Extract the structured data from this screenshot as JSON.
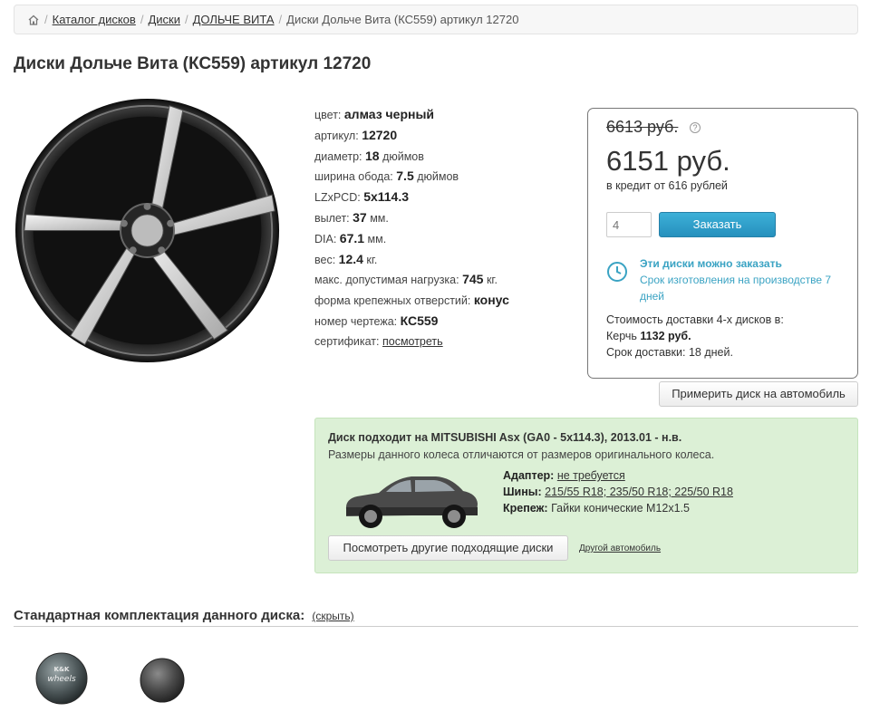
{
  "breadcrumb": {
    "items": [
      "Каталог дисков",
      "Диски",
      "ДОЛЬЧЕ ВИТА"
    ],
    "current": "Диски Дольче Вита (КС559) артикул 12720"
  },
  "title": "Диски Дольче Вита (КС559) артикул 12720",
  "specs": {
    "color_label": "цвет:",
    "color_value": "алмаз черный",
    "article_label": "артикул:",
    "article_value": "12720",
    "diameter_label": "диаметр:",
    "diameter_value": "18",
    "diameter_unit": "дюймов",
    "width_label": "ширина обода:",
    "width_value": "7.5",
    "width_unit": "дюймов",
    "pcd_label": "LZxPCD:",
    "pcd_value": "5x114.3",
    "offset_label": "вылет:",
    "offset_value": "37",
    "offset_unit": "мм.",
    "dia_label": "DIA:",
    "dia_value": "67.1",
    "dia_unit": "мм.",
    "weight_label": "вес:",
    "weight_value": "12.4",
    "weight_unit": "кг.",
    "load_label": "макс. допустимая нагрузка:",
    "load_value": "745",
    "load_unit": "кг.",
    "holes_label": "форма крепежных отверстий:",
    "holes_value": "конус",
    "drawing_label": "номер чертежа:",
    "drawing_value": "КС559",
    "cert_label": "сертификат:",
    "cert_link": "посмотреть"
  },
  "price": {
    "old": "6613 руб.",
    "help": "?",
    "current": "6151 руб.",
    "credit": "в кредит от 616 рублей",
    "qty_placeholder": "4",
    "order_button": "Заказать",
    "note_title": "Эти диски можно заказать",
    "note_text": "Срок изготовления на производстве 7 дней",
    "delivery_line1": "Стоимость доставки 4-х дисков в:",
    "delivery_city": "Керчь",
    "delivery_cost": "1132 руб.",
    "delivery_term_label": "Срок доставки:",
    "delivery_term": "18 дней."
  },
  "fit_button": "Примерить диск на автомобиль",
  "compat": {
    "title": "Диск подходит на MITSUBISHI Asx (GA0 - 5x114.3), 2013.01 - н.в.",
    "subtitle": "Размеры данного колеса отличаются от размеров оригинального колеса.",
    "adapter_label": "Адаптер:",
    "adapter_value": "не требуется",
    "tires_label": "Шины:",
    "tires_value": "215/55 R18; 235/50 R18; 225/50 R18",
    "fastener_label": "Крепеж:",
    "fastener_value": "Гайки конические M12x1.5",
    "other_disks_button": "Посмотреть другие подходящие диски",
    "other_car_link": "Другой автомобиль"
  },
  "kit": {
    "title": "Стандартная комплектация данного диска:",
    "toggle": "(скрыть)",
    "logo_text": "K&K",
    "logo_text2": "wheels"
  },
  "colors": {
    "accent_button": "#2a96c4",
    "link_teal": "#3aa3c3",
    "compat_bg": "#dcf0d6"
  }
}
